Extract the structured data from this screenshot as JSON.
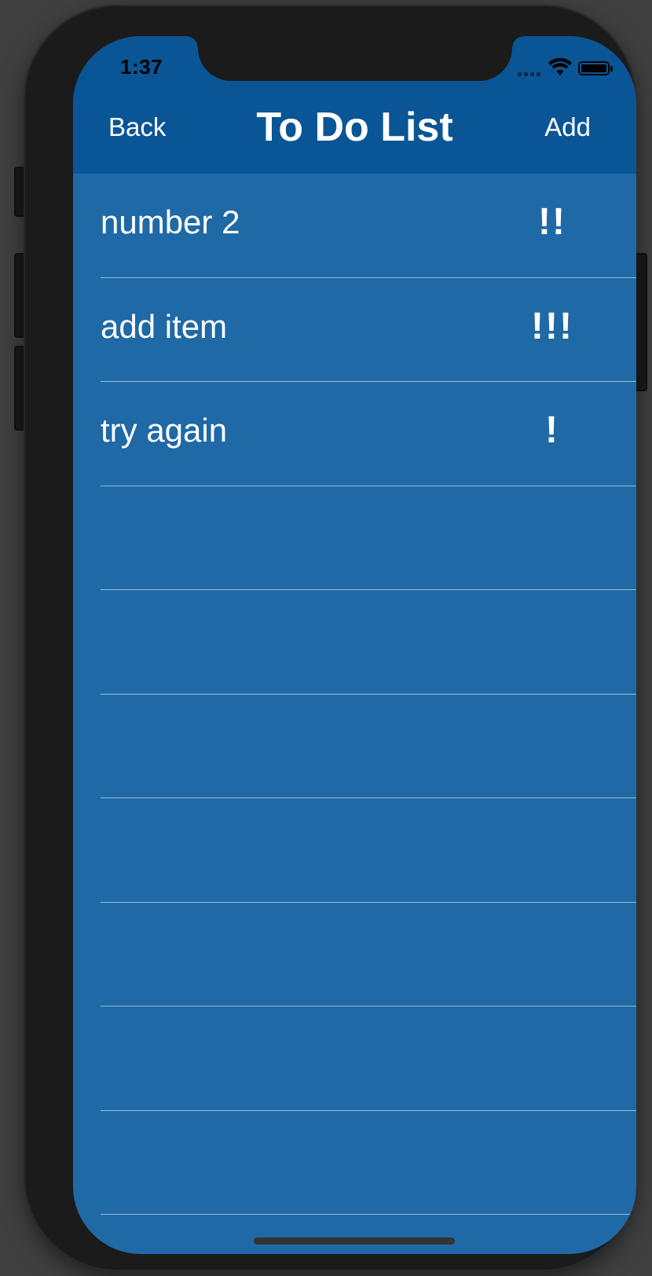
{
  "status_bar": {
    "time": "1:37"
  },
  "nav": {
    "back_label": "Back",
    "title": "To Do List",
    "add_label": "Add"
  },
  "items": [
    {
      "title": "number 2",
      "priority": "!!"
    },
    {
      "title": "add item",
      "priority": "!!!"
    },
    {
      "title": "try again",
      "priority": "!"
    }
  ],
  "colors": {
    "navbar": "#0a5596",
    "background": "#1f69a6",
    "text": "#ffffff"
  }
}
